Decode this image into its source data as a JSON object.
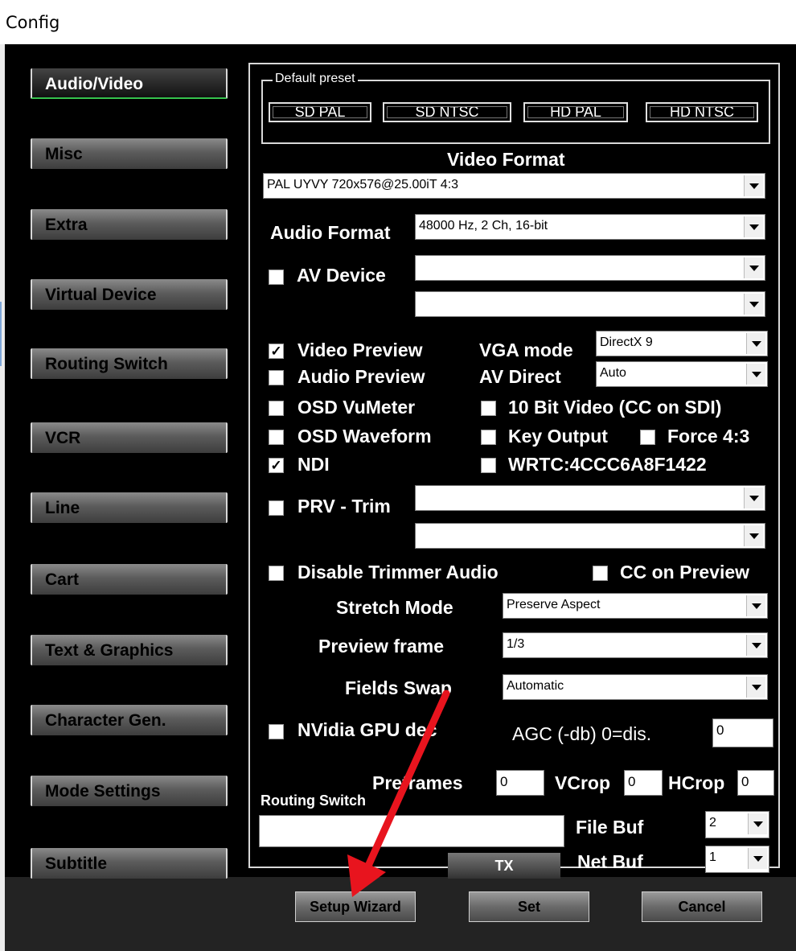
{
  "window": {
    "title": "Config"
  },
  "nav": [
    {
      "label": "Audio/Video"
    },
    {
      "label": "Misc"
    },
    {
      "label": "Extra"
    },
    {
      "label": "Virtual Device"
    },
    {
      "label": "Routing Switch"
    },
    {
      "label": "VCR"
    },
    {
      "label": "Line"
    },
    {
      "label": "Cart"
    },
    {
      "label": "Text & Graphics"
    },
    {
      "label": "Character Gen."
    },
    {
      "label": "Mode Settings"
    },
    {
      "label": "Subtitle"
    }
  ],
  "preset": {
    "label": "Default preset",
    "buttons": [
      "SD PAL",
      "SD NTSC",
      "HD PAL",
      "HD NTSC"
    ]
  },
  "video_format": {
    "label": "Video Format",
    "value": "PAL UYVY 720x576@25.00iT 4:3"
  },
  "audio_format": {
    "label": "Audio Format",
    "value": "48000 Hz, 2 Ch, 16-bit"
  },
  "av_device": {
    "label": "AV Device",
    "checked": false,
    "value1": "",
    "value2": ""
  },
  "options": {
    "video_preview": {
      "label": "Video Preview",
      "checked": true
    },
    "audio_preview": {
      "label": "Audio Preview",
      "checked": false
    },
    "osd_vumeter": {
      "label": "OSD VuMeter",
      "checked": false
    },
    "osd_waveform": {
      "label": "OSD Waveform",
      "checked": false
    },
    "ndi": {
      "label": "NDI",
      "checked": true
    },
    "ten_bit": {
      "label": "10 Bit Video (CC on SDI)",
      "checked": false
    },
    "key_output": {
      "label": "Key Output",
      "checked": false
    },
    "force43": {
      "label": "Force 4:3",
      "checked": false
    },
    "wrtc": {
      "label": "WRTC:4CCC6A8F1422",
      "checked": false
    }
  },
  "vga_mode": {
    "label": "VGA mode",
    "value": "DirectX 9"
  },
  "av_direct": {
    "label": "AV Direct",
    "value": "Auto"
  },
  "prv_trim": {
    "label": "PRV - Trim",
    "checked": false,
    "value1": "",
    "value2": ""
  },
  "disable_trimmer_audio": {
    "label": "Disable Trimmer Audio",
    "checked": false
  },
  "cc_on_preview": {
    "label": "CC on Preview",
    "checked": false
  },
  "stretch_mode": {
    "label": "Stretch Mode",
    "value": "Preserve Aspect"
  },
  "preview_frame": {
    "label": "Preview frame",
    "value": "1/3"
  },
  "fields_swap": {
    "label": "Fields Swap",
    "value": "Automatic"
  },
  "nvidia": {
    "label": "NVidia GPU dec",
    "checked": false
  },
  "agc": {
    "label": "AGC (-db) 0=dis.",
    "value": "0"
  },
  "preframes": {
    "label": "Preframes",
    "value": "0"
  },
  "vcrop": {
    "label": "VCrop",
    "value": "0"
  },
  "hcrop": {
    "label": "HCrop",
    "value": "0"
  },
  "routing_switch": {
    "label": "Routing Switch",
    "value": ""
  },
  "file_buf": {
    "label": "File Buf",
    "value": "2"
  },
  "net_buf": {
    "label": "Net Buf",
    "value": "1"
  },
  "tx_label": "TX",
  "buttons": {
    "setup_wizard": "Setup Wizard",
    "set": "Set",
    "cancel": "Cancel"
  },
  "annotation_color": "#e8141e"
}
